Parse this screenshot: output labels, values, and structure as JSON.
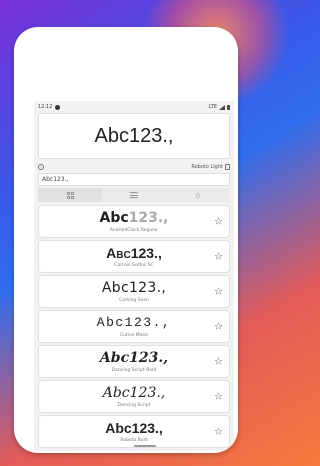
{
  "statusbar": {
    "time": "12:12",
    "network": "LTE"
  },
  "preview": {
    "text": "Abc123.,"
  },
  "info": {
    "font_name": "Roboto Light"
  },
  "input": {
    "value": "Abc123.,"
  },
  "fonts": [
    {
      "sample": "Abc",
      "sample_light": "123.,",
      "name": "AndroidClock Regular"
    },
    {
      "sample": "Abc123.,",
      "name": "Carrois Gothic SC"
    },
    {
      "sample": "Abc123.,",
      "name": "Coming Soon"
    },
    {
      "sample": "Abc123.,",
      "name": "Cutive Mono"
    },
    {
      "sample": "Abc123.,",
      "name": "Dancing Script Bold"
    },
    {
      "sample": "Abc123.,",
      "name": "Dancing Script"
    },
    {
      "sample": "Abc123.,",
      "name": "Roboto Bold"
    }
  ],
  "icons": {
    "tab_grid": "grid-icon",
    "tab_list": "list-icon",
    "tab_favorites": "star-icon",
    "favorite": "star-icon"
  }
}
